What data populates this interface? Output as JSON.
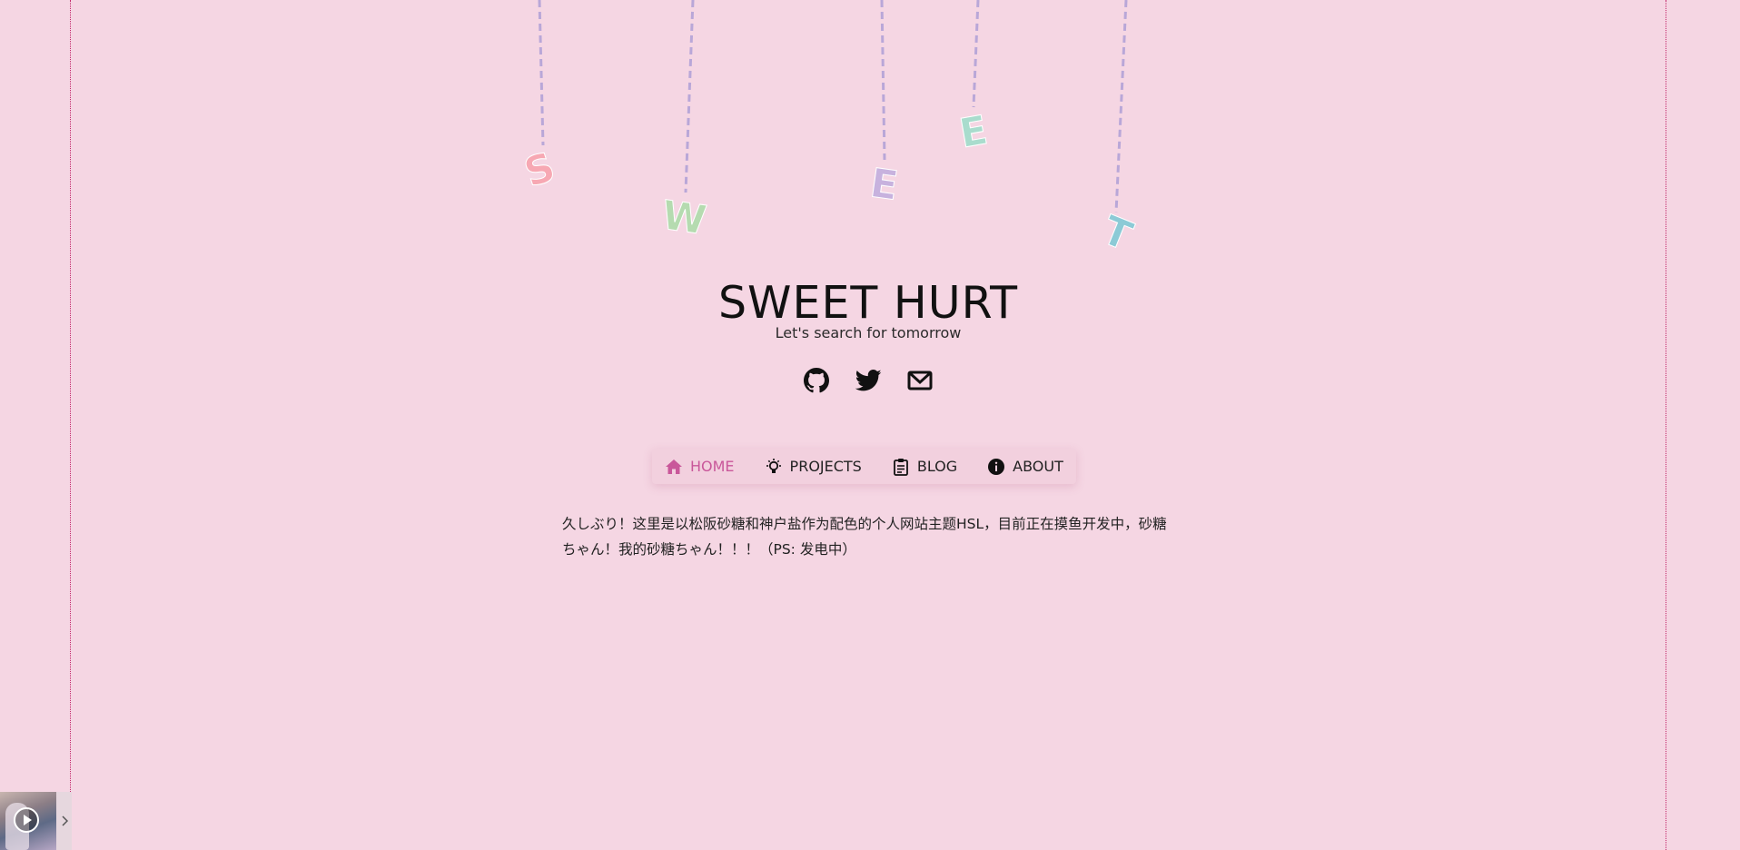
{
  "banner": {
    "letters": [
      {
        "char": "S",
        "color": "#f7a8b3"
      },
      {
        "char": "W",
        "color": "#b5dbb0"
      },
      {
        "char": "E",
        "color": "#c7b2de"
      },
      {
        "char": "E",
        "color": "#a9dccd"
      },
      {
        "char": "T",
        "color": "#8ccad6"
      }
    ],
    "string_color": "#b9a7d8"
  },
  "site": {
    "title": "SWEET HURT",
    "subtitle": "Let's search for tomorrow"
  },
  "social": {
    "items": [
      {
        "icon": "github-icon"
      },
      {
        "icon": "twitter-icon"
      },
      {
        "icon": "mail-icon"
      }
    ]
  },
  "nav": {
    "items": [
      {
        "label": "HOME",
        "icon": "home-icon",
        "active": true
      },
      {
        "label": "PROJECTS",
        "icon": "lightbulb-icon",
        "active": false
      },
      {
        "label": "BLOG",
        "icon": "clipboard-icon",
        "active": false
      },
      {
        "label": "ABOUT",
        "icon": "info-icon",
        "active": false
      }
    ],
    "active_color": "#c9579a"
  },
  "intro": {
    "text": "久しぶり！这里是以松阪砂糖和神户盐作为配色的个人网站主题HSL，目前正在摸鱼开发中，砂糖ちゃん！我的砂糖ちゃん！！！（PS: 发电中）"
  },
  "player": {
    "play_icon": "play-icon",
    "toggle_icon": "chevron-right-icon"
  },
  "colors": {
    "background": "#f5d6e3",
    "frame": "#c3266b"
  }
}
